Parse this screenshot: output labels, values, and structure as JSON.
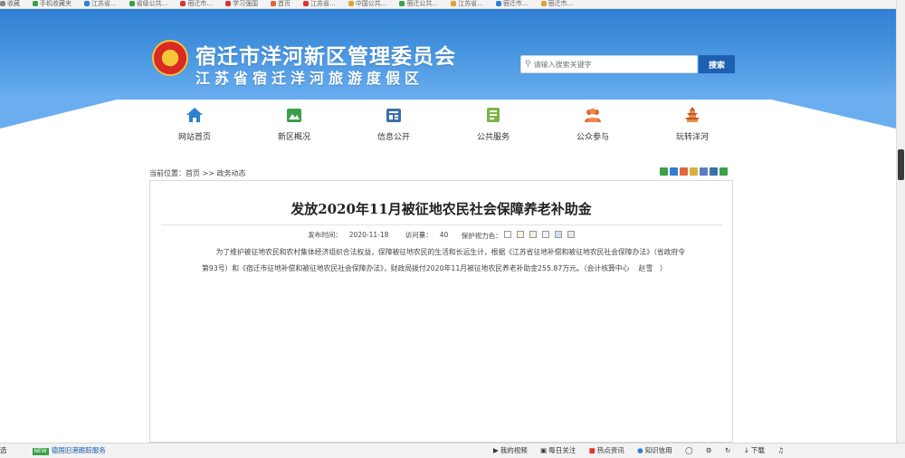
{
  "bookmarks": [
    "收藏",
    "手机收藏夹",
    "江苏省...",
    "省级公共...",
    "宿迁市...",
    "学习强国",
    "首页",
    "江苏省...",
    "中国公共...",
    "宿迁公共...",
    "江苏省...",
    "宿迁市...",
    "宿迁市..."
  ],
  "header": {
    "title": "宿迁市洋河新区管理委员会",
    "subtitle": "江苏省宿迁洋河旅游度假区",
    "search_placeholder": "请输入搜索关键字",
    "search_button": "搜索"
  },
  "nav": [
    {
      "label": "网站首页",
      "icon": "home-icon"
    },
    {
      "label": "新区概况",
      "icon": "overview-icon"
    },
    {
      "label": "信息公开",
      "icon": "info-icon"
    },
    {
      "label": "公共服务",
      "icon": "service-icon"
    },
    {
      "label": "公众参与",
      "icon": "people-icon"
    },
    {
      "label": "玩转洋河",
      "icon": "pagoda-icon"
    }
  ],
  "breadcrumb": {
    "prefix": "当前位置：",
    "home": "首页",
    "sep": " >> ",
    "current": "政务动态"
  },
  "article": {
    "title": "发放2020年11月被征地农民社会保障养老补助金",
    "publish_label": "发布时间：",
    "publish_date": "2020-11-18",
    "visits_label": "访问量：",
    "visits": "40",
    "eye_label": "保护视力色：",
    "body": "为了维护被征地农民和农村集体经济组织合法权益，保障被征地农民的生活和长远生计，根据《江苏省征地补偿和被征地农民社会保障办法》（省政府令第93号）和《宿迁市征地补偿和被征地农民社会保障办法》，财政局拨付2020年11月被征地农民养老补助金255.87万元。（会计核算中心　 赵雪　）"
  },
  "status": {
    "left_text": "选",
    "tag": "NEW",
    "link": "德国旧港跟踪服务",
    "items": [
      "我的视频",
      "每日关注",
      "热点资讯",
      "知识信用",
      "下载"
    ]
  },
  "colors": {
    "header_top": "#2f7fd3",
    "header_bottom": "#6aaef0",
    "search_button": "#1d5fb0"
  }
}
